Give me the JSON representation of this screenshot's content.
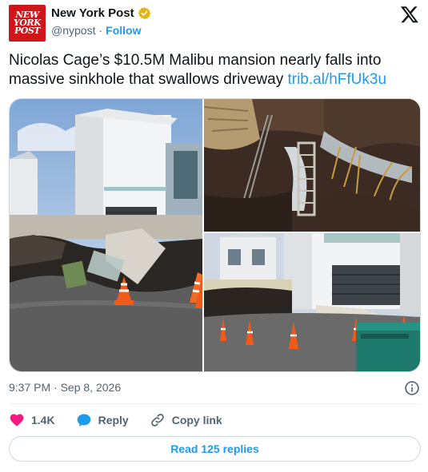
{
  "account": {
    "logo_lines": [
      "NEW",
      "YORK",
      "POST"
    ],
    "name": "New York Post",
    "handle": "@nypost",
    "separator": "·",
    "follow_label": "Follow"
  },
  "tweet": {
    "text": "Nicolas Cage’s $10.5M Malibu mansion nearly falls into massive sinkhole that swallows driveway",
    "link": "trib.al/hFfUk3u"
  },
  "meta": {
    "time": "9:37 PM",
    "separator": "·",
    "date": "Sep 8, 2026"
  },
  "actions": {
    "like_count": "1.4K",
    "reply_label": "Reply",
    "copy_label": "Copy link"
  },
  "replies_button": "Read 125 replies",
  "colors": {
    "brand_red": "#d0151b",
    "link_blue": "#1d9bf0",
    "like_pink": "#f91880",
    "verified_gold": "#e2b719",
    "muted_text": "#536471"
  },
  "icons": [
    "verified-badge-icon",
    "x-logo-icon",
    "info-icon",
    "heart-icon",
    "reply-bubble-icon",
    "link-icon"
  ]
}
